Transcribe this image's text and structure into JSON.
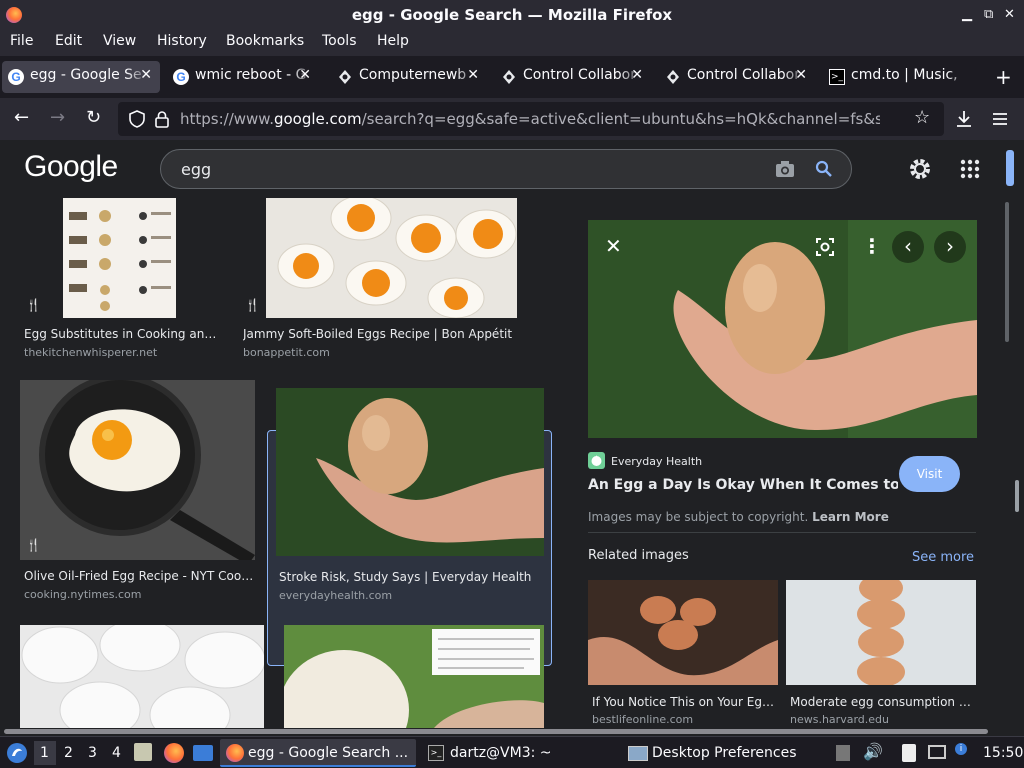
{
  "window": {
    "title": "egg - Google Search — Mozilla Firefox"
  },
  "menu": [
    "File",
    "Edit",
    "View",
    "History",
    "Bookmarks",
    "Tools",
    "Help"
  ],
  "tabs": [
    {
      "label": "egg - Google Se",
      "icon": "google-icon"
    },
    {
      "label": "wmic reboot - G",
      "icon": "google-icon"
    },
    {
      "label": "Computernewb",
      "icon": "computernewb-icon"
    },
    {
      "label": "Control Collabor",
      "icon": "computernewb-icon"
    },
    {
      "label": "Control Collabor",
      "icon": "computernewb-icon"
    },
    {
      "label": "cmd.to | Music,",
      "icon": "terminal-icon"
    }
  ],
  "url": {
    "prefix": "https://www.",
    "domain": "google.com",
    "rest": "/search?q=egg&safe=active&client=ubuntu&hs=hQk&channel=fs&source=lnms"
  },
  "google": {
    "logo": "Google",
    "query": "egg",
    "results": [
      {
        "caption": "Egg Substitutes in Cooking and B...",
        "source": "thekitchenwhisperer.net"
      },
      {
        "caption": "Jammy Soft-Boiled Eggs Recipe | Bon Appétit",
        "source": "bonappetit.com"
      },
      {
        "caption": "Olive Oil-Fried Egg Recipe - NYT Cooking",
        "source": "cooking.nytimes.com"
      },
      {
        "caption": "Stroke Risk, Study Says | Everyday Health",
        "source": "everydayhealth.com"
      }
    ],
    "panel": {
      "site": "Everyday Health",
      "title": "An Egg a Day Is Okay When It Comes to Str...",
      "visit": "Visit",
      "copyright": "Images may be subject to copyright.",
      "learn_more": "Learn More",
      "related_title": "Related images",
      "see_more": "See more",
      "related": [
        {
          "caption": "If You Notice This on Your Eggs...",
          "source": "bestlifeonline.com"
        },
        {
          "caption": "Moderate egg consumption get...",
          "source": "news.harvard.edu"
        }
      ]
    }
  },
  "taskbar": {
    "workspaces": [
      "1",
      "2",
      "3",
      "4"
    ],
    "tasks": [
      {
        "label": "egg - Google Search ..."
      },
      {
        "label": "dartz@VM3: ~"
      },
      {
        "label": "Desktop Preferences"
      }
    ],
    "clock": "15:50"
  },
  "colors": {
    "accent": "#8ab4f8",
    "visit_button": "#8ab4f8",
    "background": "#202124"
  }
}
